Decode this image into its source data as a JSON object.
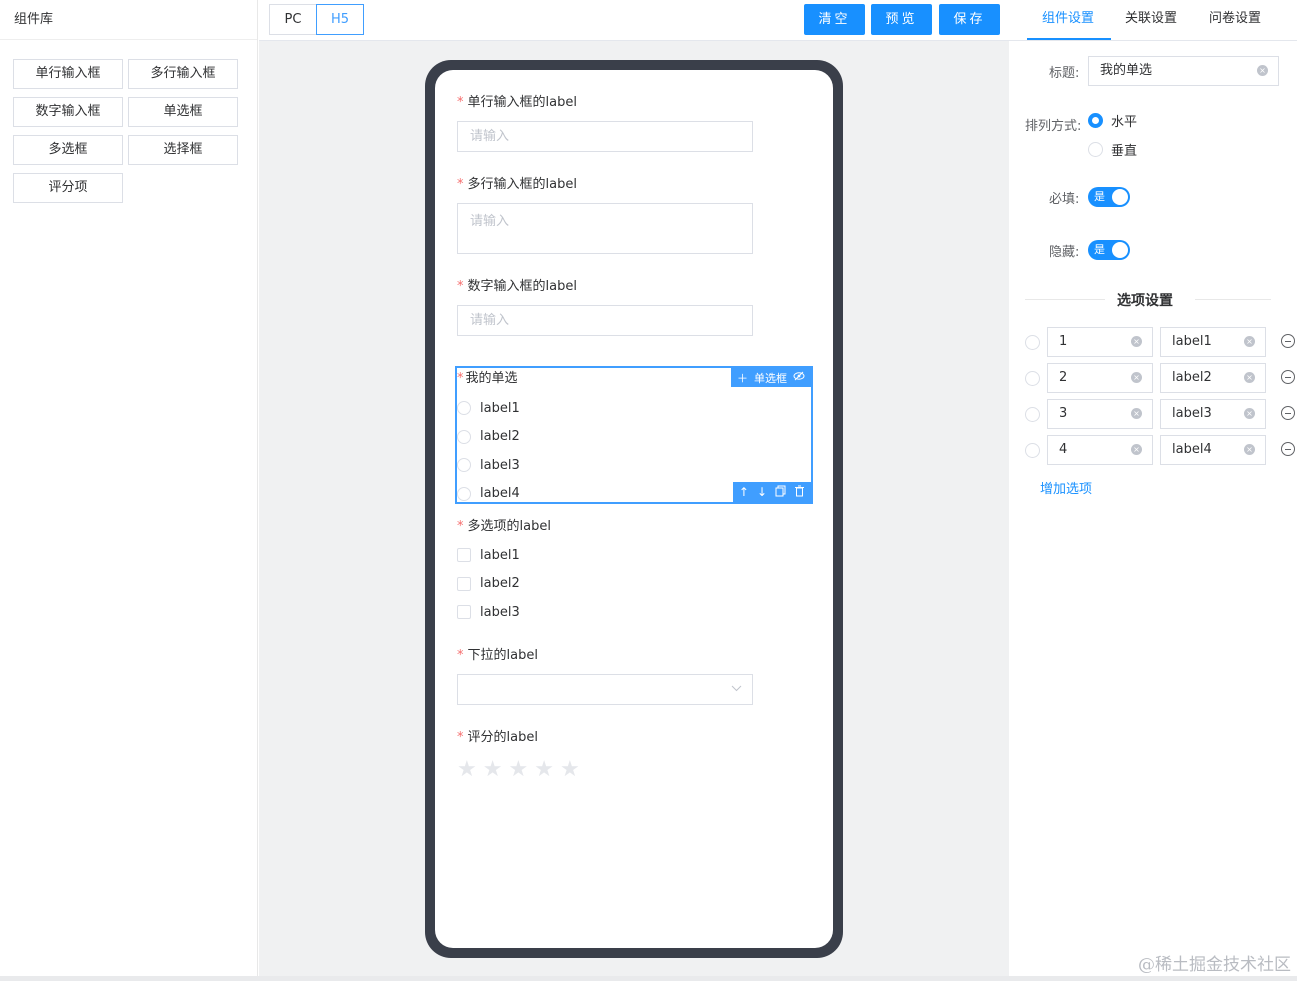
{
  "left": {
    "title": "组件库",
    "components": [
      "单行输入框",
      "多行输入框",
      "数字输入框",
      "单选框",
      "多选框",
      "选择框",
      "评分项"
    ]
  },
  "toolbar": {
    "mode_pc": "PC",
    "mode_h5": "H5",
    "clear": "清空",
    "preview": "预览",
    "save": "保存"
  },
  "form": {
    "input": {
      "label": "单行输入框的label",
      "placeholder": "请输入"
    },
    "textarea": {
      "label": "多行输入框的label",
      "placeholder": "请输入"
    },
    "number": {
      "label": "数字输入框的label",
      "placeholder": "请输入"
    },
    "radio": {
      "label": "我的单选",
      "tag": "单选框",
      "options": [
        "label1",
        "label2",
        "label3",
        "label4"
      ]
    },
    "checkbox": {
      "label": "多选项的label",
      "options": [
        "label1",
        "label2",
        "label3"
      ]
    },
    "select": {
      "label": "下拉的label"
    },
    "rate": {
      "label": "评分的label",
      "stars": 5
    }
  },
  "right": {
    "tabs": [
      "组件设置",
      "关联设置",
      "问卷设置"
    ],
    "active_tab": 0,
    "title_label": "标题:",
    "title_value": "我的单选",
    "layout_label": "排列方式:",
    "layout_options": [
      "水平",
      "垂直"
    ],
    "layout_selected": 0,
    "required_label": "必填:",
    "required_switch": "是",
    "hidden_label": "隐藏:",
    "hidden_switch": "是",
    "options_title": "选项设置",
    "options": [
      {
        "value": "1",
        "label": "label1"
      },
      {
        "value": "2",
        "label": "label2"
      },
      {
        "value": "3",
        "label": "label3"
      },
      {
        "value": "4",
        "label": "label4"
      }
    ],
    "add_option": "增加选项"
  },
  "watermark": "@稀土掘金技术社区",
  "colors": {
    "primary": "#1890ff",
    "required": "#f56c6c",
    "phone_frame": "#3a3f4a"
  }
}
